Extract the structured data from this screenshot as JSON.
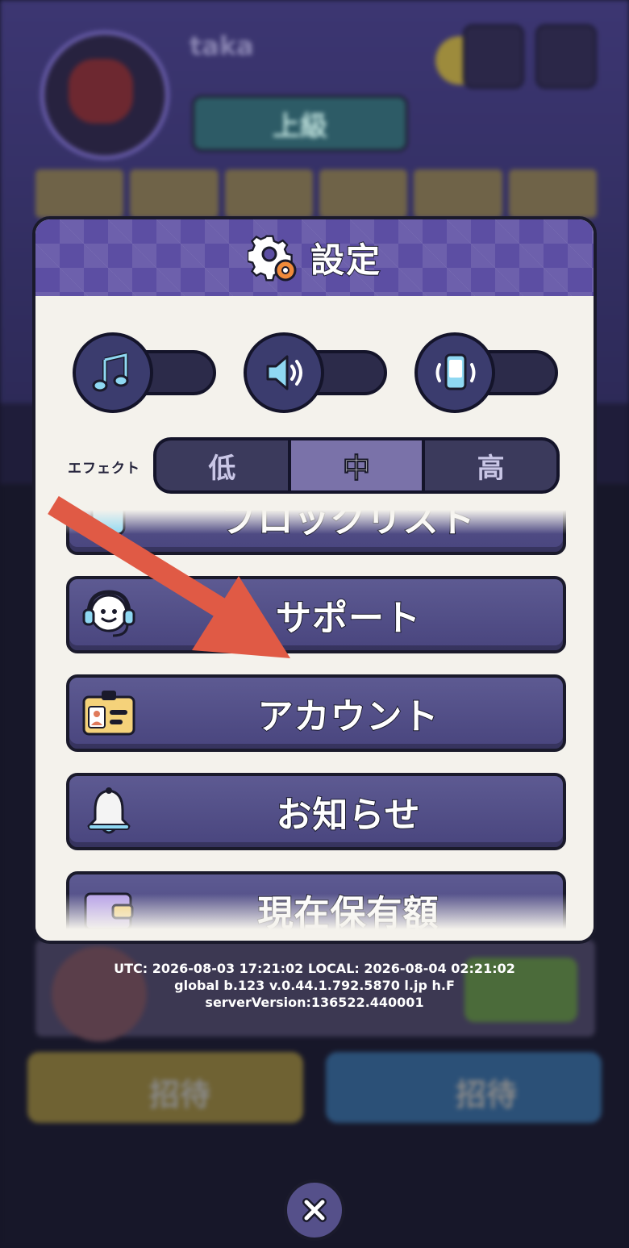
{
  "background": {
    "player_name": "taka",
    "rank_label": "上級",
    "invite_buttons": [
      "招待",
      "招待"
    ]
  },
  "dialog": {
    "title": "設定",
    "title_icon": "gear-icon",
    "sliders": [
      {
        "icon": "music-note-icon",
        "name": "bgm"
      },
      {
        "icon": "speaker-icon",
        "name": "sound-effects"
      },
      {
        "icon": "phone-vibrate-icon",
        "name": "vibration"
      }
    ],
    "effect": {
      "label": "エフェクト",
      "options": [
        "低",
        "中",
        "高"
      ],
      "selected": "中"
    },
    "menu": [
      {
        "label": "ブロックリスト",
        "icon": "block-list-icon"
      },
      {
        "label": "サポート",
        "icon": "headset-icon"
      },
      {
        "label": "アカウント",
        "icon": "id-card-icon"
      },
      {
        "label": "お知らせ",
        "icon": "bell-icon"
      },
      {
        "label": "現在保有額",
        "icon": "wallet-icon"
      }
    ]
  },
  "version_info": {
    "line1": "UTC: 2026-08-03 17:21:02 LOCAL: 2026-08-04 02:21:02",
    "line2": "global b.123 v.0.44.1.792.5870 l.jp h.F",
    "line3": "serverVersion:136522.440001"
  },
  "annotation": {
    "arrow_color": "#e05a45",
    "points_to": "アカウント"
  },
  "colors": {
    "header": "#5c4ea3",
    "button": "#5d5a92",
    "panel": "#f4f2ec"
  }
}
